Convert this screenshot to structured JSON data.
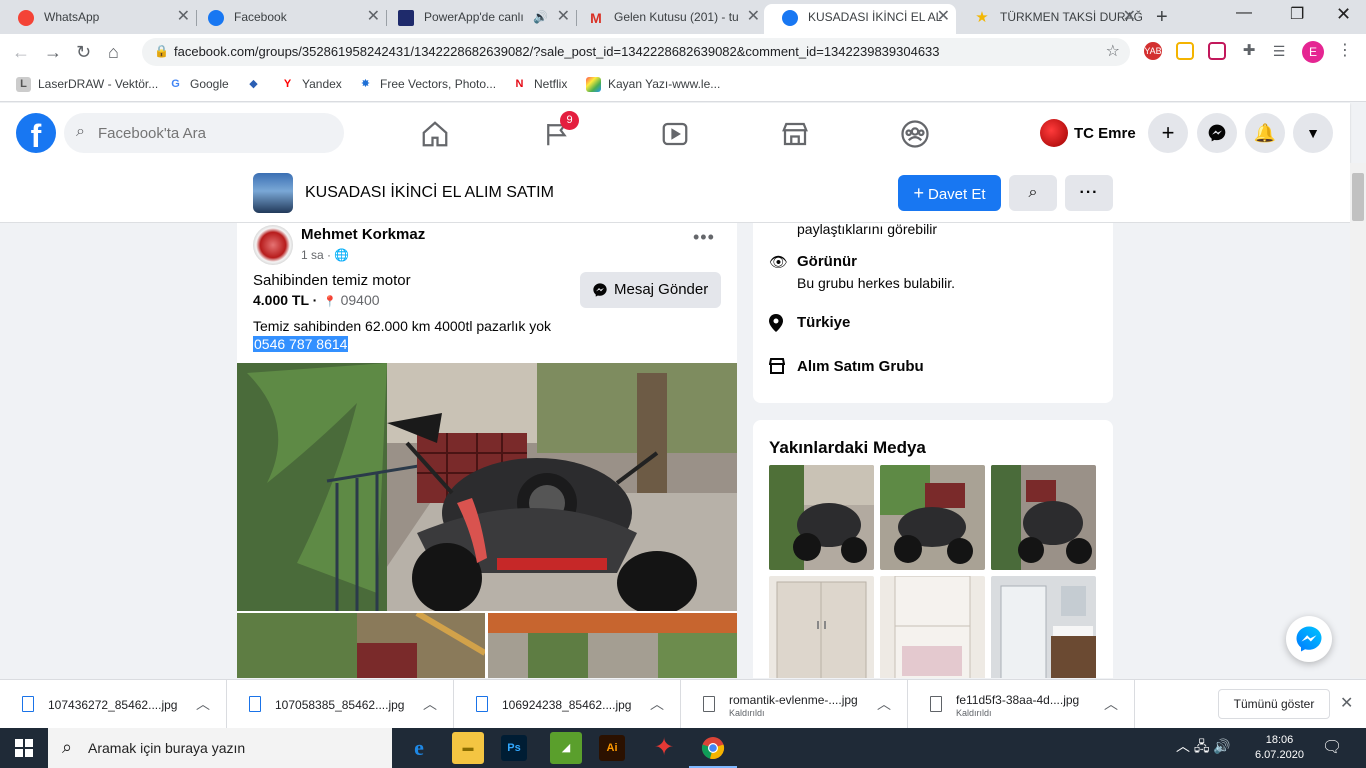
{
  "browser": {
    "tabs": [
      {
        "title": "WhatsApp",
        "color": "#f44336"
      },
      {
        "title": "Facebook",
        "color": "#1877f2"
      },
      {
        "title": "PowerApp'de canlı",
        "color": "#1e2a6b"
      },
      {
        "title": "Gelen Kutusu (201) - tu",
        "color": "#d93025"
      },
      {
        "title": "KUSADASI İKİNCİ EL AL",
        "color": "#1877f2"
      },
      {
        "title": "TÜRKMEN TAKSİ DURAĞ",
        "color": "#f2b705"
      }
    ],
    "url": "facebook.com/groups/352861958242431/1342228682639082/?sale_post_id=1342228682639082&comment_id=1342239839304633",
    "bookmarks": [
      {
        "label": "LaserDRAW - Vektör...",
        "icon": "L",
        "color": "#777"
      },
      {
        "label": "Google",
        "icon": "G",
        "color": "#4285f4"
      },
      {
        "label": "",
        "icon": "◆",
        "color": "#2b5fb4"
      },
      {
        "label": "Yandex",
        "icon": "Y",
        "color": "#ff0000"
      },
      {
        "label": "Free Vectors, Photo...",
        "icon": "✸",
        "color": "#1d6fd6"
      },
      {
        "label": "Netflix",
        "icon": "N",
        "color": "#e50914"
      },
      {
        "label": "Kayan Yazı-www.le...",
        "icon": "◈",
        "color": "#a24ab5"
      }
    ],
    "extensions": [
      {
        "label": "YAB",
        "color": "#d32f2f"
      },
      {
        "label": "",
        "color": "#f4b400"
      },
      {
        "label": "",
        "color": "#c2185b"
      }
    ],
    "profile_initial": "E"
  },
  "fb": {
    "search_placeholder": "Facebook'ta Ara",
    "notification_badge": "9",
    "user_name": "TC Emre",
    "brand_color": "#1877f2"
  },
  "group": {
    "name": "KUSADASI İKİNCİ EL ALIM SATIM",
    "invite_label": "Davet Et"
  },
  "post": {
    "author": "Mehmet Korkmaz",
    "time": "1 sa",
    "title": "Sahibinden temiz motor",
    "price": "4.000 TL ·",
    "location": "09400",
    "message_button": "Mesaj Gönder",
    "description": "Temiz sahibinden 62.000 km 4000tl pazarlık yok",
    "phone": "0546 787 8614"
  },
  "about": {
    "partial_text": "paylaştıklarını görebilir",
    "visible_title": "Görünür",
    "visible_sub": "Bu grubu herkes bulabilir.",
    "location": "Türkiye",
    "category": "Alım Satım Grubu"
  },
  "media": {
    "title": "Yakınlardaki Medya"
  },
  "downloads": {
    "items": [
      {
        "name": "107436272_85462....jpg",
        "status": ""
      },
      {
        "name": "107058385_85462....jpg",
        "status": ""
      },
      {
        "name": "106924238_85462....jpg",
        "status": ""
      },
      {
        "name": "romantik-evlenme-....jpg",
        "status": "Kaldırıldı"
      },
      {
        "name": "fe11d5f3-38aa-4d....jpg",
        "status": "Kaldırıldı"
      }
    ],
    "show_all": "Tümünü göster"
  },
  "taskbar": {
    "search_placeholder": "Aramak için buraya yazın",
    "time": "18:06",
    "date": "6.07.2020",
    "apps": [
      {
        "label": "e",
        "color": "#1e88e5",
        "fg": "#ffffff"
      },
      {
        "label": "▬",
        "color": "#f4c542",
        "fg": "#8a6d00"
      },
      {
        "label": "Ps",
        "color": "#001d34",
        "fg": "#31a8ff"
      },
      {
        "label": "◢",
        "color": "#5a9f2c",
        "fg": "#ffffff"
      },
      {
        "label": "Ai",
        "color": "#2b1100",
        "fg": "#ff9a00"
      },
      {
        "label": "✦",
        "color": "#1f2a37",
        "fg": "#e53935"
      },
      {
        "label": "◉",
        "color": "#1f2a37",
        "fg": "#34a853"
      }
    ]
  }
}
